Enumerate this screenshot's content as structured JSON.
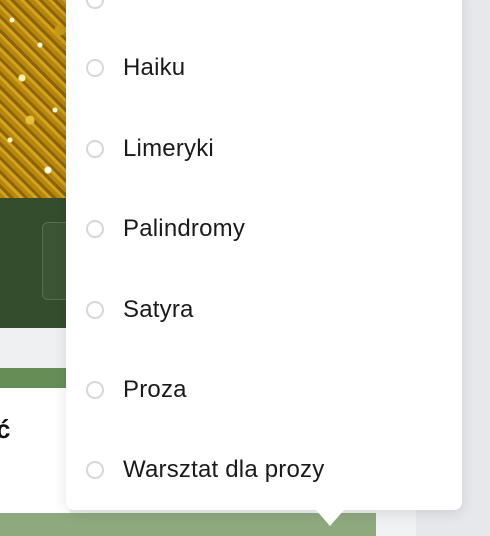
{
  "background": {
    "accent_dark_green": "#344d2c",
    "accent_green": "#678d57",
    "card_partial_text": "ć"
  },
  "dropdown": {
    "options": [
      {
        "label": "Haiku",
        "selected": false
      },
      {
        "label": "Limeryki",
        "selected": false
      },
      {
        "label": "Palindromy",
        "selected": false
      },
      {
        "label": "Satyra",
        "selected": false
      },
      {
        "label": "Proza",
        "selected": false
      },
      {
        "label": "Warsztat dla prozy",
        "selected": false
      }
    ]
  }
}
